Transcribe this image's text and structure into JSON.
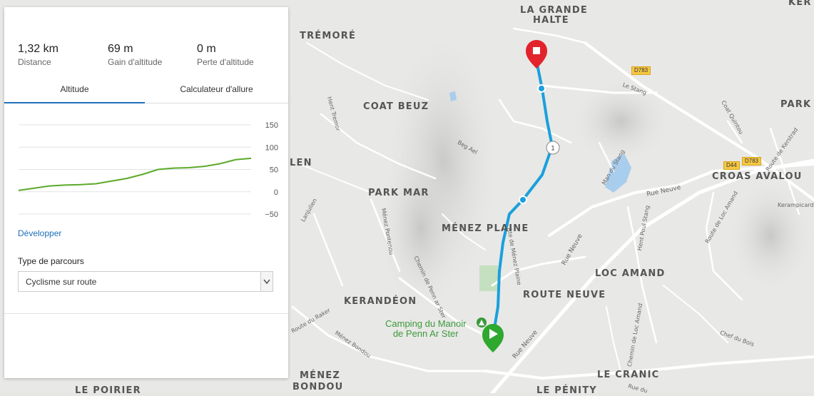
{
  "panel": {
    "stats": [
      {
        "value": "1,32 km",
        "label": "Distance"
      },
      {
        "value": "69 m",
        "label": "Gain d'altitude"
      },
      {
        "value": "0 m",
        "label": "Perte d'altitude"
      }
    ],
    "tabs": [
      {
        "label": "Altitude",
        "active": true
      },
      {
        "label": "Calculateur d'allure",
        "active": false
      }
    ],
    "expand_link": "Développer",
    "route_type_label": "Type de parcours",
    "route_type_value": "Cyclisme sur route"
  },
  "elevation_chart": {
    "y_ticks": [
      "150",
      "100",
      "50",
      "0",
      "−50"
    ],
    "y_range": [
      -50,
      150
    ],
    "line_color": "#5aaa2a",
    "profile": [
      3,
      8,
      13,
      15,
      16,
      18,
      24,
      30,
      39,
      50,
      53,
      54,
      57,
      63,
      72,
      75
    ]
  },
  "map": {
    "labels": {
      "la_grande_halte_1": "LA GRANDE",
      "la_grande_halte_2": "HALTE",
      "tremore": "TRÉMORÉ",
      "coat_beuz": "COAT BEUZ",
      "park_mar": "PARK MAR",
      "menez_plaine": "MÉNEZ PLAINE",
      "kerandeon": "KERANDÉON",
      "route_neuve": "ROUTE NEUVE",
      "loc_amand": "LOC AMAND",
      "croas_avalou": "CROAS AVALOU",
      "park": "PARK",
      "ker": "KER",
      "le_cranic": "LE CRANIC",
      "le_penity": "LE PÉNITY",
      "le_poirier": "LE POIRIER",
      "menez_bondou_1": "MÉNEZ",
      "menez_bondou_2": "BONDOU",
      "len": "LEN"
    },
    "streets": {
      "rue_neuve": "Rue Neuve",
      "le_stang": "Le Stang",
      "beg_ael": "Beg Ael",
      "hent_tremor": "Hent Tremor",
      "coat_quintou": "Coat Quintou",
      "route_de_kerstrad": "Route de Kerstrad",
      "man_du_stang": "Man du Stang",
      "hent_poul_stang": "Hent Poul Stang",
      "route_de_loc_amand": "Route de Loc Amand",
      "kerampicard": "Kerampicard",
      "lanjulien": "Lanjulien",
      "menez_pontenou": "Ménez Pontenou",
      "chemin_de_penn_ar_ster": "Chemin de Penn ar Ster",
      "route_du_raker": "Route du Raker",
      "menez_bondou": "Ménez Bondou",
      "chemin_de_loc_amand": "Chemin de Loc Amand",
      "chef_du_bois": "Chef du Bois",
      "rue_du": "Rue du",
      "route_de_menez_plaine": "Rte de Ménez Plaine"
    },
    "road_badges": [
      "D783",
      "D44",
      "D783"
    ],
    "poi": {
      "line1": "Camping du Manoir",
      "line2": "de Penn Ar Ster"
    },
    "marker_number": "1",
    "route_color": "#1aa0dc",
    "start_color": "#2ea82e",
    "end_color": "#e2232b"
  }
}
